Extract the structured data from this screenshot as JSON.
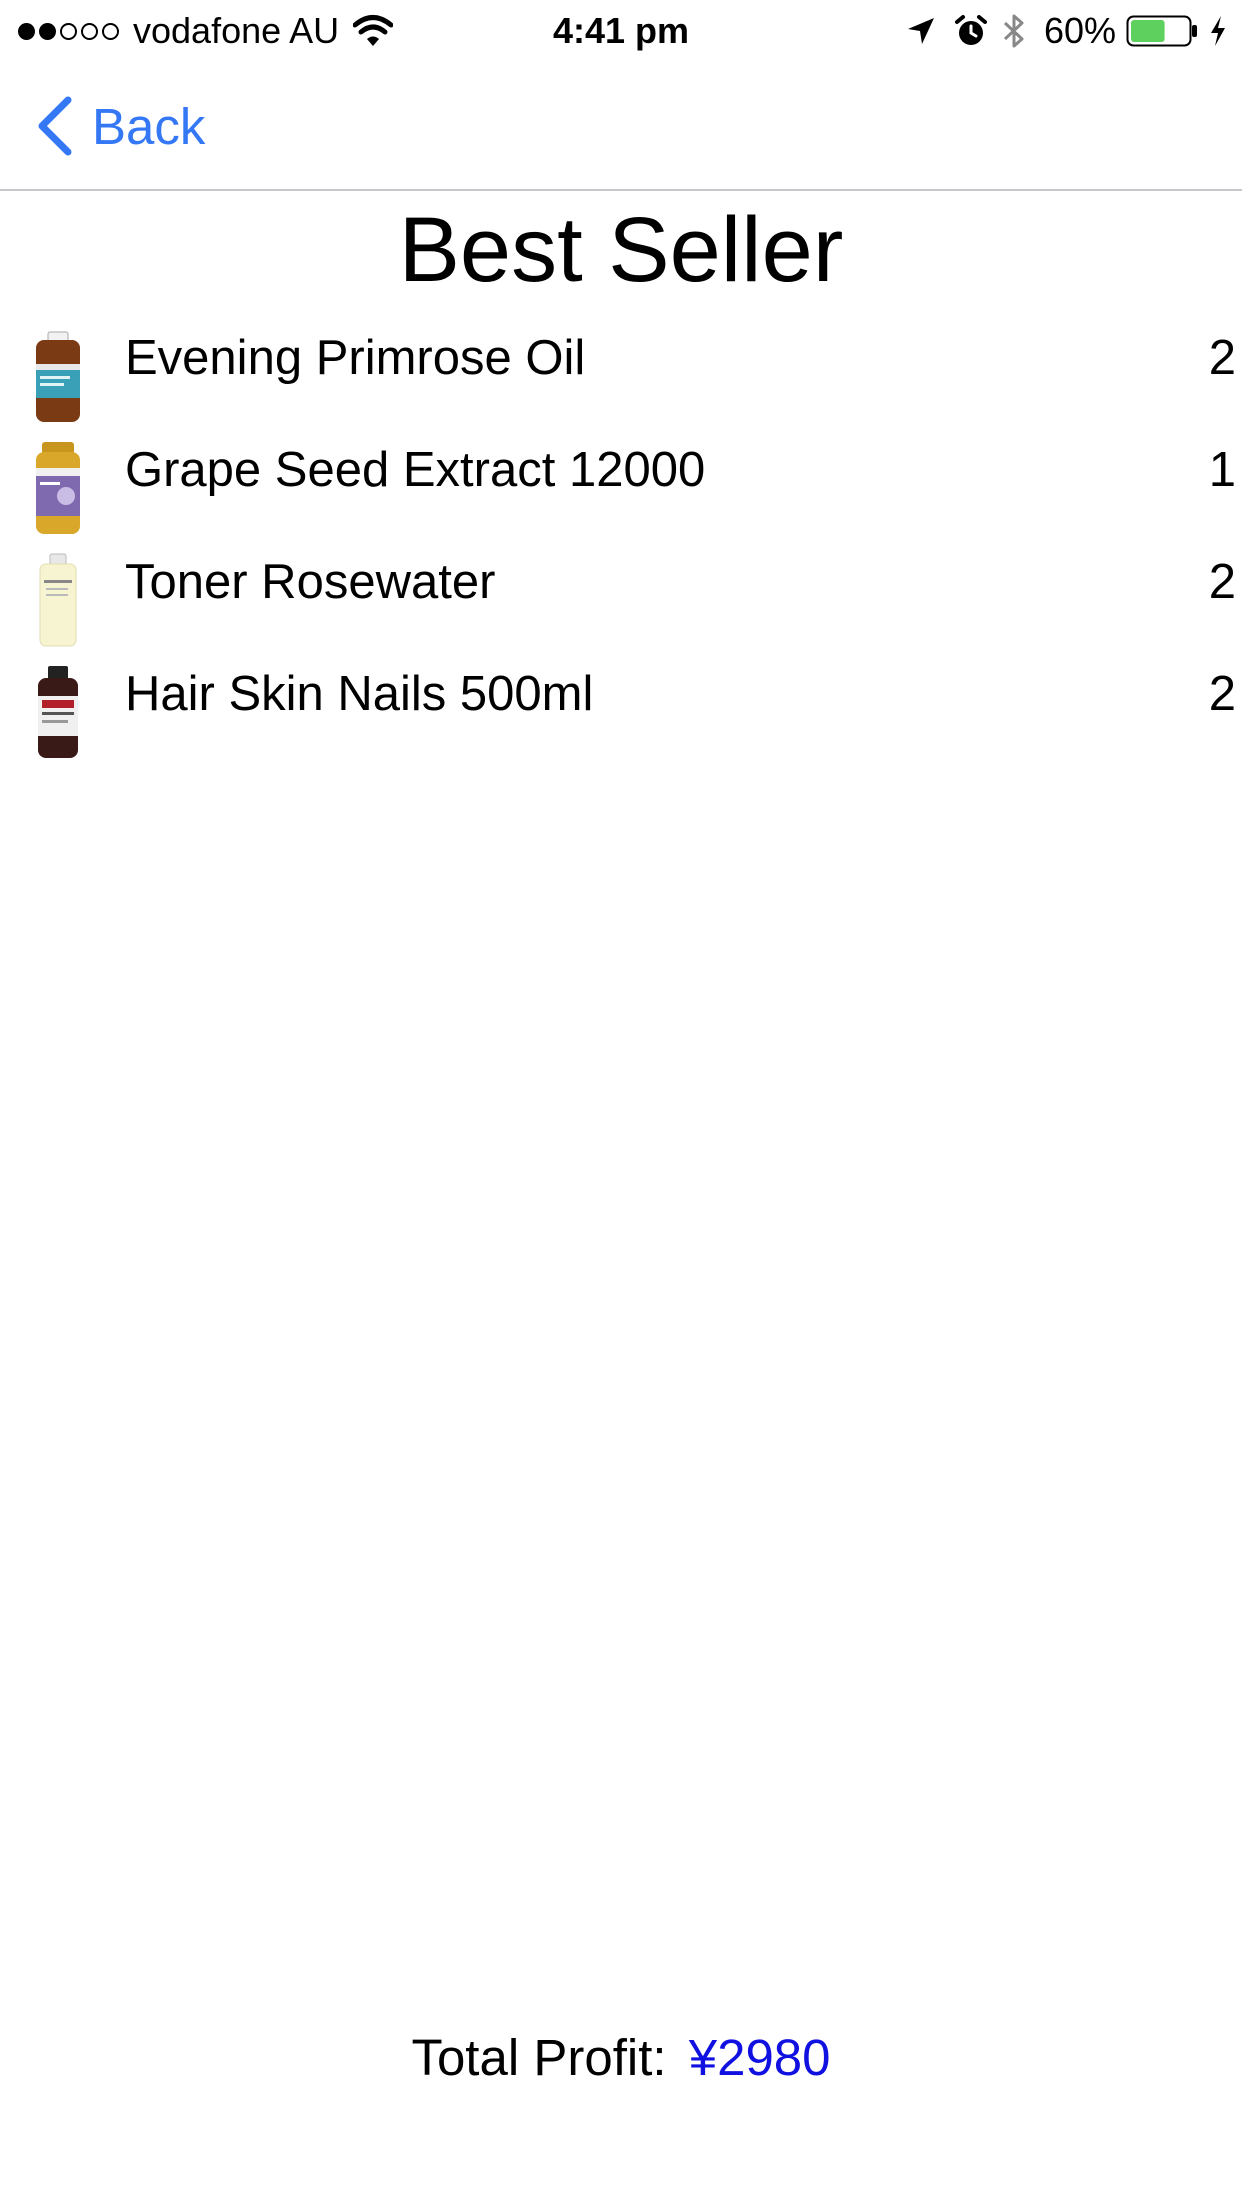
{
  "status_bar": {
    "signal_filled": 2,
    "signal_total": 5,
    "carrier": "vodafone AU",
    "time": "4:41 pm",
    "battery_percent": "60%",
    "battery_level": 0.6,
    "battery_color": "#5dd05d",
    "icons": [
      "wifi-icon",
      "location-icon",
      "alarm-icon",
      "bluetooth-icon",
      "battery-icon",
      "charging-icon"
    ]
  },
  "nav": {
    "back_label": "Back",
    "accent_color": "#3478f6"
  },
  "page": {
    "title": "Best Seller"
  },
  "items": [
    {
      "name": "Evening Primrose Oil",
      "count": "2",
      "thumb": "bottle-brown-blue-label"
    },
    {
      "name": "Grape Seed Extract 12000",
      "count": "1",
      "thumb": "bottle-gold-purple-label"
    },
    {
      "name": "Toner Rosewater",
      "count": "2",
      "thumb": "bottle-clear-yellow"
    },
    {
      "name": "Hair Skin Nails 500ml",
      "count": "2",
      "thumb": "bottle-dark-red-label"
    }
  ],
  "footer": {
    "profit_label": "Total Profit:",
    "profit_value": "¥2980",
    "profit_color": "#1010e0"
  }
}
